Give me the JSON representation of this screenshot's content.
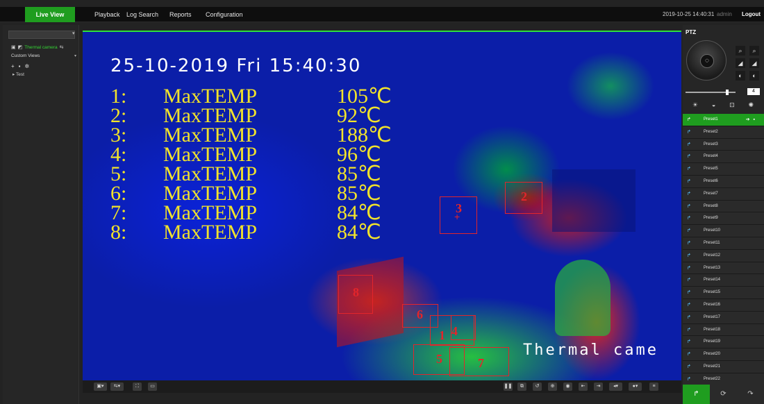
{
  "nav": {
    "tabs": [
      "Live View",
      "Playback",
      "Log Search",
      "Reports",
      "Configuration"
    ],
    "datetime": "2019-10-25 14:40:31",
    "user": "admin",
    "logout": "Logout"
  },
  "left": {
    "camera_name": "Thermal camera",
    "views_label": "Custom Views",
    "tree_item": "Test"
  },
  "osd": {
    "datetime": "25-10-2019 Fri 15:40:30",
    "rows": [
      {
        "n": "1:",
        "label": "MaxTEMP",
        "value": "105℃"
      },
      {
        "n": "2:",
        "label": "MaxTEMP",
        "value": "92℃"
      },
      {
        "n": "3:",
        "label": "MaxTEMP",
        "value": "188℃"
      },
      {
        "n": "4:",
        "label": "MaxTEMP",
        "value": "96℃"
      },
      {
        "n": "5:",
        "label": "MaxTEMP",
        "value": "85℃"
      },
      {
        "n": "6:",
        "label": "MaxTEMP",
        "value": "85℃"
      },
      {
        "n": "7:",
        "label": "MaxTEMP",
        "value": "84℃"
      },
      {
        "n": "8:",
        "label": "MaxTEMP",
        "value": "84℃"
      }
    ],
    "camera_label": "Thermal came",
    "box_ids": [
      "1",
      "2",
      "3",
      "4",
      "5",
      "6",
      "7",
      "8"
    ]
  },
  "ptz": {
    "title": "PTZ",
    "speed": "4",
    "presets": [
      "Preset1",
      "Preset2",
      "Preset3",
      "Preset4",
      "Preset5",
      "Preset6",
      "Preset7",
      "Preset8",
      "Preset9",
      "Preset10",
      "Preset11",
      "Preset12",
      "Preset13",
      "Preset14",
      "Preset15",
      "Preset16",
      "Preset17",
      "Preset18",
      "Preset19",
      "Preset20",
      "Preset21",
      "Preset22"
    ]
  }
}
